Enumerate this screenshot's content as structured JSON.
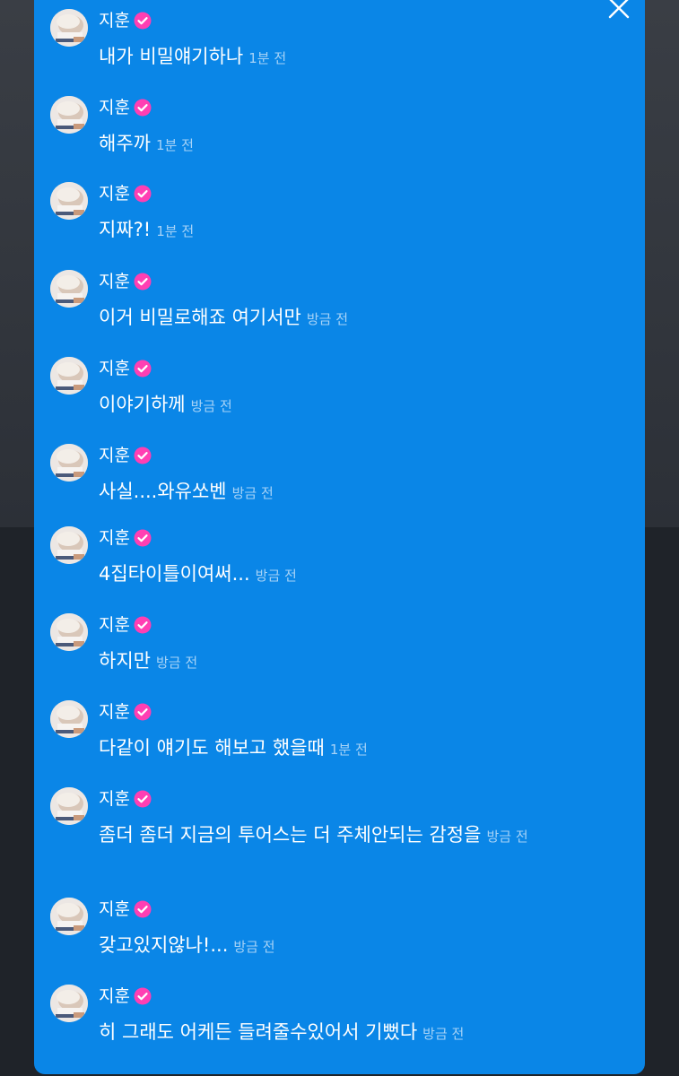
{
  "chat": {
    "close_icon": "close-icon",
    "verified_icon": "verified-badge-icon",
    "colors": {
      "panel": "#0a86e7",
      "badge": "#ff3fb3",
      "text": "#ffffff",
      "time": "#a7d3f7"
    },
    "messages": [
      {
        "user": "지훈",
        "text": "내가 비밀얘기하나",
        "time": "1분 전"
      },
      {
        "user": "지훈",
        "text": "해주까",
        "time": "1분 전"
      },
      {
        "user": "지훈",
        "text": "지짜?!",
        "time": "1분 전"
      },
      {
        "user": "지훈",
        "text": "이거 비밀로해죠 여기서만",
        "time": "방금 전"
      },
      {
        "user": "지훈",
        "text": "이야기하께",
        "time": "방금 전"
      },
      {
        "user": "지훈",
        "text": "사실....와유쏘벤",
        "time": "방금 전"
      },
      {
        "user": "지훈",
        "text": "4집타이틀이여써...",
        "time": "방금 전"
      },
      {
        "user": "지훈",
        "text": "하지만",
        "time": "방금 전"
      },
      {
        "user": "지훈",
        "text": "다같이 얘기도 해보고 했을때",
        "time": "1분 전"
      },
      {
        "user": "지훈",
        "text": "좀더 좀더 지금의 투어스는 더 주체안되는 감정을",
        "time": "방금 전"
      },
      {
        "user": "지훈",
        "text": "갖고있지않나!...",
        "time": "방금 전"
      },
      {
        "user": "지훈",
        "text": "히 그래도 어케든 들려줄수있어서 기뻤다",
        "time": "방금 전"
      }
    ]
  }
}
